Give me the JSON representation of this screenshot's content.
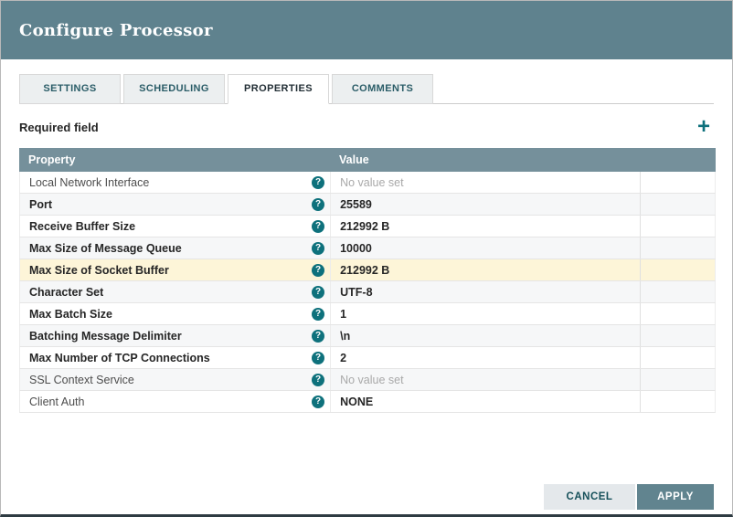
{
  "dialog": {
    "title": "Configure Processor"
  },
  "tabs": [
    {
      "label": "SETTINGS",
      "active": false
    },
    {
      "label": "SCHEDULING",
      "active": false
    },
    {
      "label": "PROPERTIES",
      "active": true
    },
    {
      "label": "COMMENTS",
      "active": false
    }
  ],
  "icons": {
    "plus": "+",
    "help": "?"
  },
  "properties_tab": {
    "required_field_label": "Required field",
    "table": {
      "columns": [
        "Property",
        "Value"
      ],
      "rows": [
        {
          "property": "Local Network Interface",
          "value": "No value set",
          "required": false,
          "value_set": false,
          "highlighted": false
        },
        {
          "property": "Port",
          "value": "25589",
          "required": true,
          "value_set": true,
          "highlighted": false
        },
        {
          "property": "Receive Buffer Size",
          "value": "212992 B",
          "required": true,
          "value_set": true,
          "highlighted": false
        },
        {
          "property": "Max Size of Message Queue",
          "value": "10000",
          "required": true,
          "value_set": true,
          "highlighted": false
        },
        {
          "property": "Max Size of Socket Buffer",
          "value": "212992 B",
          "required": true,
          "value_set": true,
          "highlighted": true
        },
        {
          "property": "Character Set",
          "value": "UTF-8",
          "required": true,
          "value_set": true,
          "highlighted": false
        },
        {
          "property": "Max Batch Size",
          "value": "1",
          "required": true,
          "value_set": true,
          "highlighted": false
        },
        {
          "property": "Batching Message Delimiter",
          "value": "\\n",
          "required": true,
          "value_set": true,
          "highlighted": false
        },
        {
          "property": "Max Number of TCP Connections",
          "value": "2",
          "required": true,
          "value_set": true,
          "highlighted": false
        },
        {
          "property": "SSL Context Service",
          "value": "No value set",
          "required": false,
          "value_set": false,
          "highlighted": false
        },
        {
          "property": "Client Auth",
          "value": "NONE",
          "required": false,
          "value_set": true,
          "highlighted": false
        }
      ]
    }
  },
  "footer": {
    "cancel_label": "CANCEL",
    "apply_label": "APPLY"
  },
  "colors": {
    "header_bg": "#5f828e",
    "table_header_bg": "#75909b",
    "accent": "#0e717c",
    "apply_bg": "#61848f",
    "cancel_bg": "#e4e8eb",
    "cancel_text": "#16505a",
    "highlight_row_bg": "#fdf5d8",
    "alt_row_bg": "#f6f7f8"
  }
}
